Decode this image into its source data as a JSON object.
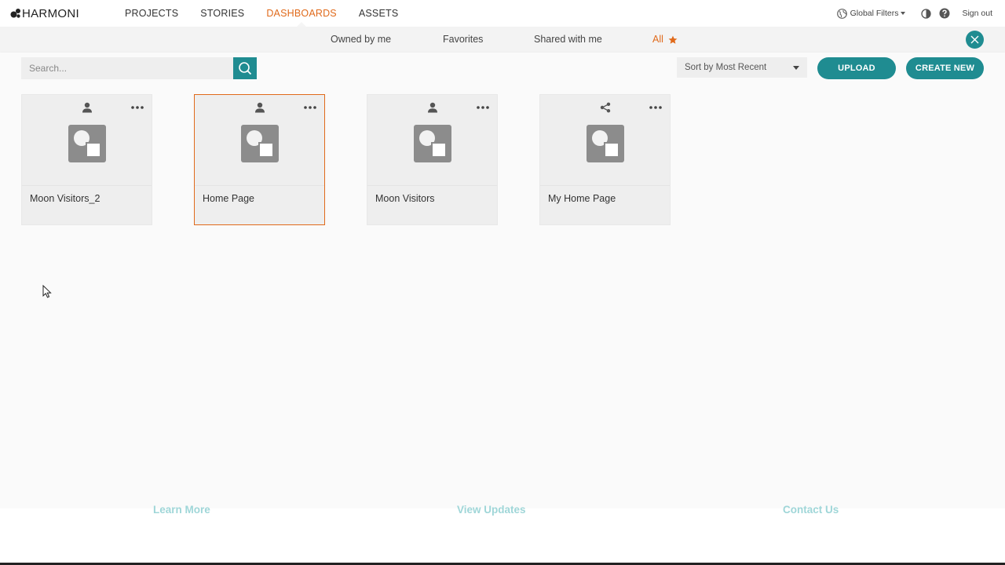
{
  "brand": {
    "name": "HARMONI"
  },
  "nav": {
    "items": [
      {
        "label": "PROJECTS",
        "active": false
      },
      {
        "label": "STORIES",
        "active": false
      },
      {
        "label": "DASHBOARDS",
        "active": true
      },
      {
        "label": "ASSETS",
        "active": false
      }
    ]
  },
  "toolbar": {
    "global_filters": "Global Filters",
    "sign_out": "Sign out"
  },
  "filters": {
    "owned": "Owned by me",
    "favorites": "Favorites",
    "shared": "Shared with me",
    "all": "All",
    "active": "all"
  },
  "search": {
    "placeholder": "Search..."
  },
  "sort": {
    "selected": "Sort by Most Recent"
  },
  "actions": {
    "upload": "UPLOAD",
    "create_new": "CREATE NEW"
  },
  "dashboards": [
    {
      "title": "Moon Visitors_2",
      "owner_icon": "user-icon",
      "selected": false
    },
    {
      "title": "Home Page",
      "owner_icon": "user-icon",
      "selected": true
    },
    {
      "title": "Moon Visitors",
      "owner_icon": "user-icon",
      "selected": false
    },
    {
      "title": "My Home Page",
      "owner_icon": "share-icon",
      "selected": false
    }
  ],
  "footer": {
    "learn_more": "Learn More",
    "view_updates": "View Updates",
    "contact_us": "Contact Us"
  },
  "colors": {
    "accent": "#e06a1b",
    "primary": "#1f8c91",
    "footer_link": "#9fd6d8"
  }
}
